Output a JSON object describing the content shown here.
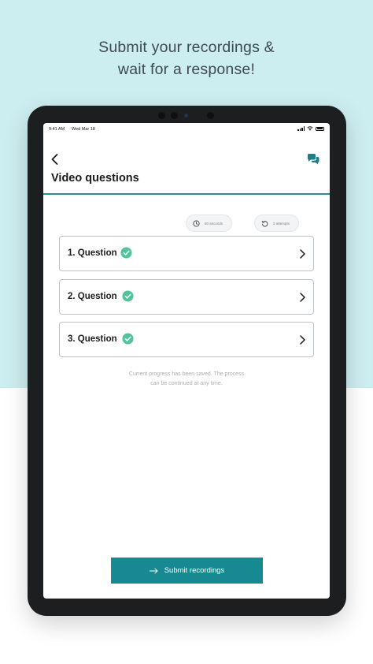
{
  "promo": {
    "line1": "Submit your recordings &",
    "line2": "wait for a response!"
  },
  "statusbar": {
    "time": "9:41 AM",
    "date": "Wed Mar 18"
  },
  "header": {
    "title": "Video questions",
    "back_icon": "chevron-left-icon",
    "chat_icon": "chat-bubbles-icon"
  },
  "info_pills": [
    {
      "text": "60 seconds",
      "icon": "clock-icon"
    },
    {
      "text": "3 attempts",
      "icon": "retry-icon"
    }
  ],
  "questions": [
    {
      "label": "1. Question",
      "status": "completed"
    },
    {
      "label": "2. Question",
      "status": "completed"
    },
    {
      "label": "3. Question",
      "status": "completed"
    }
  ],
  "saved_note": {
    "line1": "Current progress has been saved. The process",
    "line2": "can be continued at any time."
  },
  "submit": {
    "label": "Submit recordings",
    "icon": "arrow-right-icon"
  },
  "colors": {
    "accent": "#168a90",
    "check": "#52c49a",
    "promo_bg": "#cdeef0"
  }
}
